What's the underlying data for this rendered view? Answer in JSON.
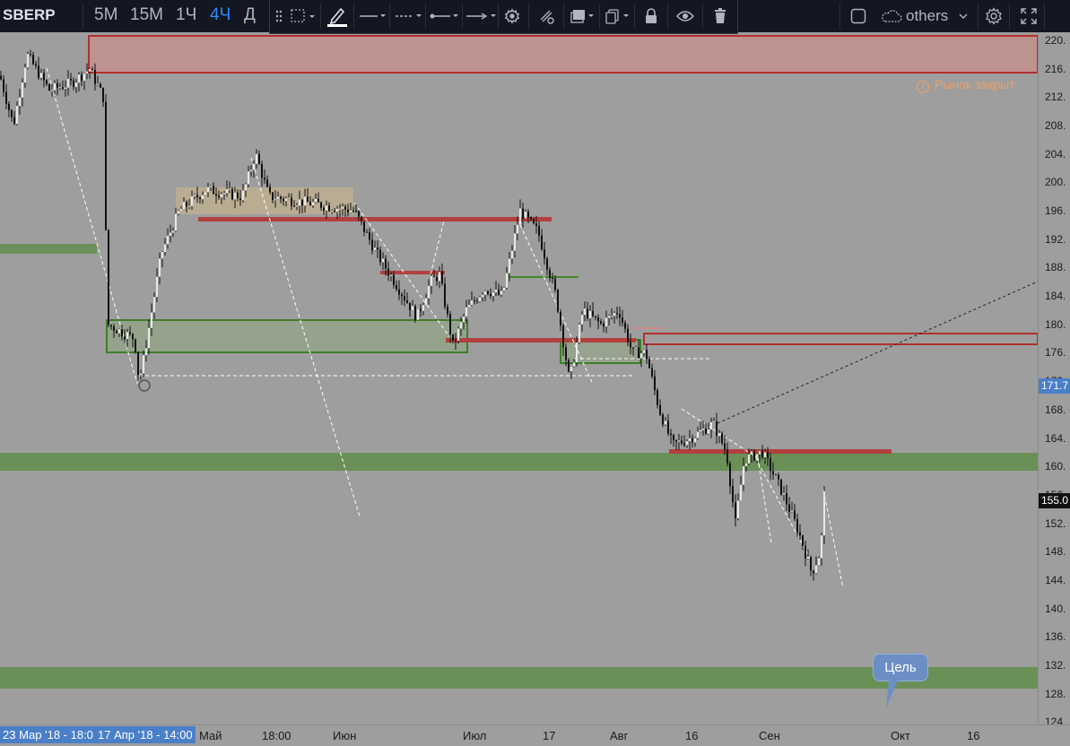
{
  "symbol": "SBERP",
  "timeframes": [
    {
      "label": "5М",
      "active": false
    },
    {
      "label": "15М",
      "active": false
    },
    {
      "label": "1Ч",
      "active": false
    },
    {
      "label": "4Ч",
      "active": true
    },
    {
      "label": "Д",
      "active": false
    }
  ],
  "drawing_toolbar": {
    "tools": [
      "select-rect-icon",
      "pencil-icon",
      "line-style-solid-icon",
      "line-style-dashed-icon",
      "line-start-icon",
      "line-end-icon",
      "settings-icon",
      "clone-icon",
      "layers-icon",
      "copy-icon",
      "lock-icon",
      "eye-icon",
      "trash-icon"
    ]
  },
  "right_toolbar": {
    "layout_label": "others",
    "icons": [
      "square-icon",
      "cloud-icon",
      "chevron-down-icon",
      "gear-icon",
      "fullscreen-icon"
    ]
  },
  "market_status": "Рынок закрыт",
  "price_axis": {
    "ticks": [
      "220.",
      "216.",
      "212.",
      "208.",
      "204.",
      "200.",
      "196.",
      "192.",
      "188.",
      "184.",
      "180.",
      "176.",
      "172.",
      "168.",
      "164.",
      "160.",
      "156.",
      "152.",
      "148.",
      "144.",
      "140.",
      "136.",
      "132.",
      "128.",
      "124."
    ],
    "badges": [
      {
        "label": "171.7",
        "bg": "#4a7fc9",
        "color": "#ffffff",
        "price": 171.4
      },
      {
        "label": "155.0",
        "bg": "#111111",
        "color": "#ffffff",
        "price": 155.2
      }
    ]
  },
  "time_axis": {
    "badges": [
      "23 Мар '18 - 18:0",
      "17 Апр '18 - 14:00"
    ],
    "labels": [
      "Май",
      "18:00",
      "Июн",
      "Июл",
      "17",
      "Авг",
      "16",
      "Сен",
      "Окт",
      "16"
    ]
  },
  "annotation": {
    "text": "Цель"
  },
  "colors": {
    "background": "#9e9e9e",
    "toolbar": "#131722",
    "accent_blue": "#2a8cff",
    "support_green": "#5b8a4e",
    "resistance_red": "#b2302d"
  },
  "chart_data": {
    "type": "candlestick",
    "symbol": "SBERP",
    "timeframe": "4Ч",
    "ylim": [
      123,
      222
    ],
    "anchors": [
      [
        0,
        215
      ],
      [
        15,
        208
      ],
      [
        30,
        218
      ],
      [
        55,
        213
      ],
      [
        80,
        214
      ],
      [
        100,
        216
      ],
      [
        115,
        212
      ],
      [
        120,
        180
      ],
      [
        150,
        178
      ],
      [
        155,
        172
      ],
      [
        160,
        175
      ],
      [
        180,
        190
      ],
      [
        200,
        196
      ],
      [
        230,
        199
      ],
      [
        270,
        198
      ],
      [
        285,
        204
      ],
      [
        300,
        198
      ],
      [
        350,
        197
      ],
      [
        395,
        196
      ],
      [
        420,
        190
      ],
      [
        440,
        186
      ],
      [
        465,
        181
      ],
      [
        480,
        186
      ],
      [
        490,
        187
      ],
      [
        505,
        177
      ],
      [
        520,
        182
      ],
      [
        540,
        185
      ],
      [
        560,
        184
      ],
      [
        580,
        196
      ],
      [
        600,
        193
      ],
      [
        620,
        184
      ],
      [
        635,
        172
      ],
      [
        650,
        182
      ],
      [
        670,
        180
      ],
      [
        690,
        182
      ],
      [
        705,
        176
      ],
      [
        720,
        176
      ],
      [
        735,
        168
      ],
      [
        750,
        163
      ],
      [
        770,
        164
      ],
      [
        795,
        166
      ],
      [
        810,
        162
      ],
      [
        820,
        152
      ],
      [
        830,
        161
      ],
      [
        850,
        162
      ],
      [
        870,
        157
      ],
      [
        890,
        151
      ],
      [
        905,
        145
      ],
      [
        915,
        148
      ],
      [
        921,
        160
      ]
    ],
    "levels": [
      {
        "kind": "resistance",
        "low": 215.5,
        "high": 222
      },
      {
        "kind": "support",
        "price": 160.5
      },
      {
        "kind": "support",
        "price": 130.5
      },
      {
        "kind": "support",
        "price": 191
      }
    ]
  }
}
